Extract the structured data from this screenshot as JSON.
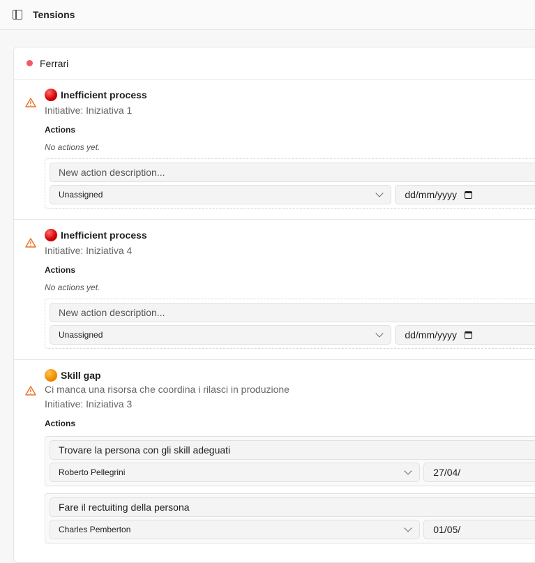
{
  "header": {
    "title": "Tensions"
  },
  "group": {
    "name": "Ferrari",
    "color": "#ef5a6b"
  },
  "tensions": [
    {
      "title": "Inefficient process",
      "initiative": "Initiative: Iniziativa 1",
      "actions_heading": "Actions",
      "empty_text": "No actions yet.",
      "new_action_placeholder": "New action description...",
      "assignee": "Unassigned",
      "date_placeholder": "dd/mm/yyyy"
    },
    {
      "title": "Inefficient process",
      "initiative": "Initiative: Iniziativa 4",
      "actions_heading": "Actions",
      "empty_text": "No actions yet.",
      "new_action_placeholder": "New action description...",
      "assignee": "Unassigned",
      "date_placeholder": "dd/mm/yyyy"
    },
    {
      "title": "Skill gap",
      "description": "Ci manca una risorsa che coordina i rilasci in produzione",
      "initiative": "Initiative: Iniziativa 3",
      "actions_heading": "Actions",
      "actions": [
        {
          "description": "Trovare la persona con gli skill adeguati",
          "assignee": "Roberto Pellegrini",
          "date": "27/04/"
        },
        {
          "description": "Fare il rectuiting della persona",
          "assignee": "Charles Pemberton",
          "date": "01/05/"
        }
      ]
    }
  ]
}
